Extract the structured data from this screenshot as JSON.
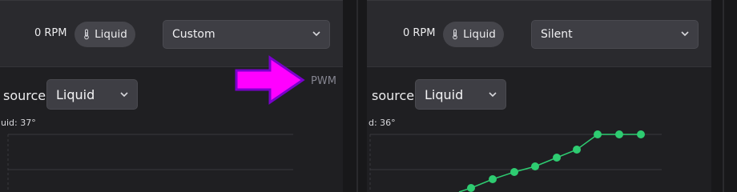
{
  "left_panel": {
    "rpm": "0 RPM",
    "sensor_chip": "Liquid",
    "profile_select": "Custom",
    "source_label": "source:",
    "source_select": "Liquid",
    "temp_readout": "uid: 37°",
    "chart_axis_label": "PWM"
  },
  "right_panel": {
    "rpm": "0 RPM",
    "sensor_chip": "Liquid",
    "profile_select": "Silent",
    "source_label": "source:",
    "source_select": "Liquid",
    "temp_readout": "d: 36°"
  },
  "colors": {
    "curve": "#2ecc71",
    "annotation_arrow": "#ff00ff",
    "annotation_arrow_border": "#7a00cc"
  },
  "icons": {
    "sensor": "thermometer-icon",
    "dropdown": "chevron-down-icon",
    "annotation": "arrow-right-icon"
  }
}
